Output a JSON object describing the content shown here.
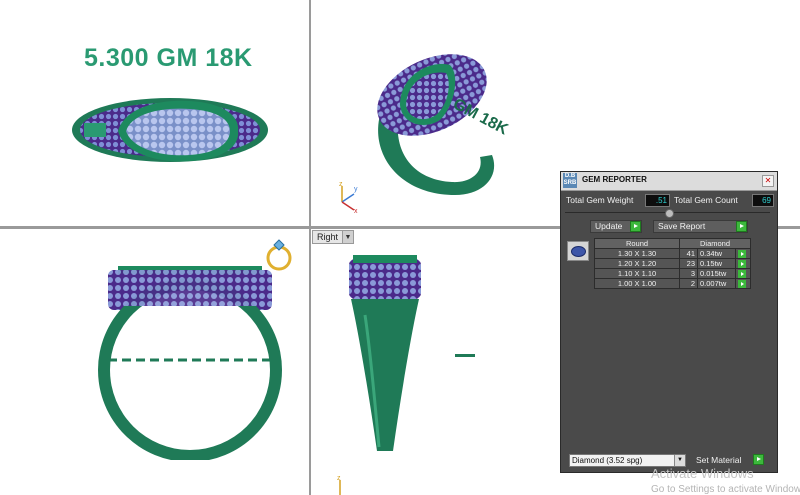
{
  "viewport": {
    "weight_label": "5.300 GM 18K",
    "persp_text": "GM 18K",
    "view_label": "Right",
    "axis_x": "x",
    "axis_y": "y",
    "axis_z": "z"
  },
  "gem_reporter": {
    "title": "GEM REPORTER",
    "logo_text": "D.B SRB",
    "total_weight_label": "Total Gem Weight",
    "total_weight_value": ".51",
    "total_count_label": "Total Gem Count",
    "total_count_value": "69",
    "update_label": "Update",
    "save_report_label": "Save Report",
    "headers": [
      "Round",
      "Diamond"
    ],
    "rows": [
      {
        "size": "1.30 X 1.30",
        "count": "41",
        "weight": "0.34tw"
      },
      {
        "size": "1.20 X 1.20",
        "count": "23",
        "weight": "0.15tw"
      },
      {
        "size": "1.10 X 1.10",
        "count": "3",
        "weight": "0.015tw"
      },
      {
        "size": "1.00 X 1.00",
        "count": "2",
        "weight": "0.007tw"
      }
    ],
    "material_value": "Diamond    (3.52 spg)",
    "set_material_label": "Set Material"
  },
  "watermark": {
    "line1": "Activate Windows",
    "line2": "Go to Settings to activate Windows."
  },
  "colors": {
    "metal": "#1f7a57",
    "stone": "#a8b8e8",
    "prong": "#6a2a9a",
    "label": "#2a9a72",
    "panel_bg": "#4a4a4a",
    "value_text": "#2fd1d1"
  }
}
